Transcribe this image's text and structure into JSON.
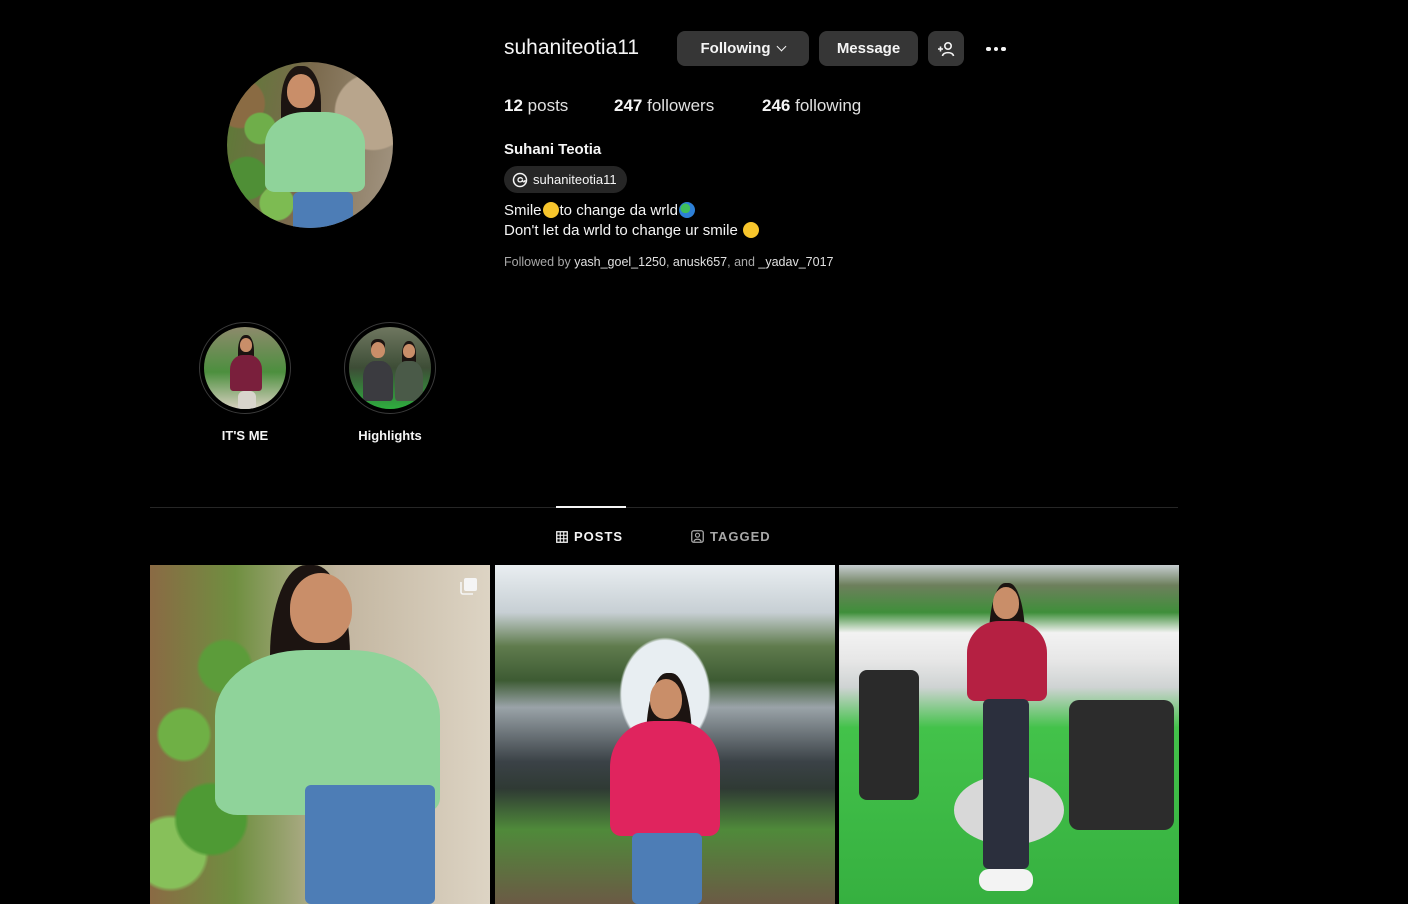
{
  "profile": {
    "username": "suhaniteotia11",
    "full_name": "Suhani Teotia",
    "threads_handle": "suhaniteotia11",
    "bio_line1_a": "Smile",
    "bio_line1_b": "to change da wrld",
    "bio_line2": "Don't let da wrld to change ur smile",
    "avatar_icon": "profile-photo"
  },
  "actions": {
    "following_label": "Following",
    "message_label": "Message"
  },
  "stats": {
    "posts_count": "12",
    "posts_label": "posts",
    "followers_count": "247",
    "followers_label": "followers",
    "following_count": "246",
    "following_label": "following"
  },
  "followed_by": {
    "prefix": "Followed by",
    "user1": "yash_goel_1250",
    "user2": "anusk657",
    "joiner": "and",
    "user3": "_yadav_7017"
  },
  "highlights": [
    {
      "label": "IT'S ME"
    },
    {
      "label": "Highlights"
    }
  ],
  "tabs": {
    "posts": "POSTS",
    "tagged": "TAGGED"
  },
  "colors": {
    "background": "#000000",
    "button": "#363636",
    "text": "#f5f5f5",
    "muted": "#a8a8a8"
  }
}
